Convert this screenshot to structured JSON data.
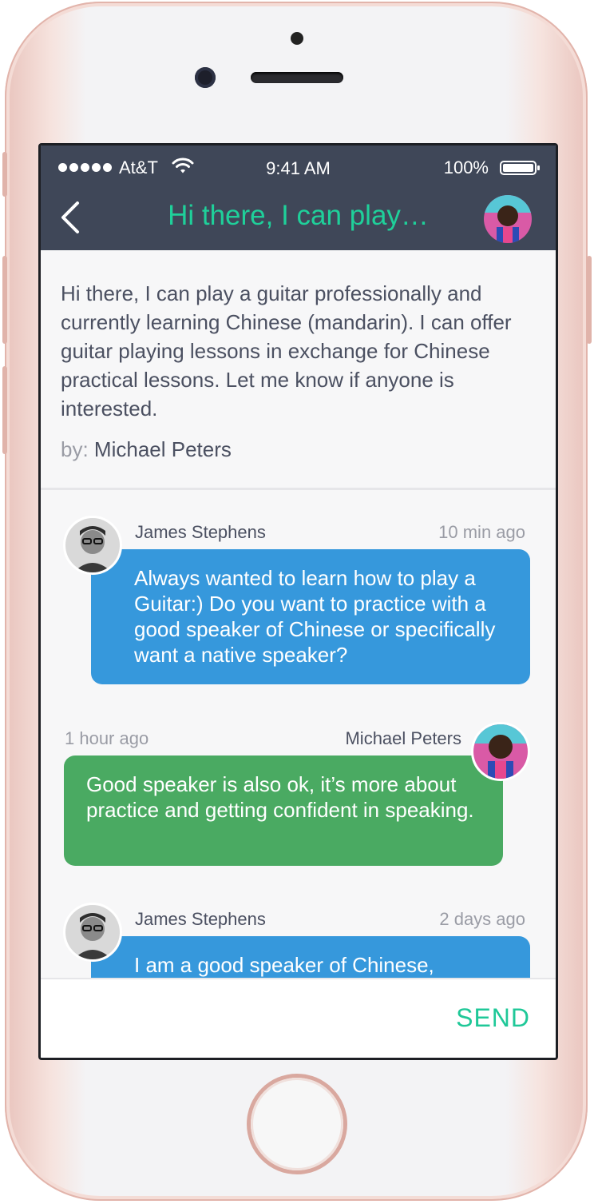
{
  "status_bar": {
    "carrier": "At&T",
    "time": "9:41 AM",
    "battery": "100%"
  },
  "nav": {
    "title": "Hi there, I can play…"
  },
  "post": {
    "text": "Hi there, I can play a guitar professionally and currently learning Chinese (mandarin). I can offer guitar playing lessons in exchange for Chinese practical lessons. Let me know if anyone is interested.",
    "by_label": "by:",
    "author": "Michael Peters"
  },
  "comments": [
    {
      "author": "James Stephens",
      "time": "10 min ago",
      "text": "Always wanted to learn how to play a Guitar:) Do you want to practice with a good speaker of Chinese or specifically want a native speaker?"
    },
    {
      "author": "Michael Peters",
      "time": "1 hour ago",
      "text": "Good speaker is also ok, it’s more about practice and getting confident in speaking."
    },
    {
      "author": "James Stephens",
      "time": "2 days ago",
      "text": "I am a good speaker of Chinese,"
    }
  ],
  "composer": {
    "send_label": "SEND"
  },
  "colors": {
    "header_bg": "#3f4758",
    "accent": "#1fd09a",
    "bubble_blue": "#3698dc",
    "bubble_green": "#4aaa62"
  }
}
